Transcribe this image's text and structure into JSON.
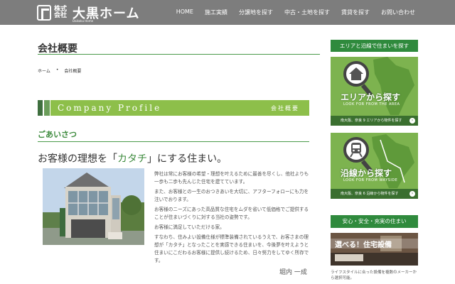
{
  "header": {
    "logo_small": "株式会社",
    "logo_big": "大黒ホーム",
    "logo_sub": "Daikoku Home",
    "nav": [
      "HOME",
      "施工実績",
      "分譲地を探す",
      "中古・土地を探す",
      "賃貸を探す",
      "お問い合わせ"
    ]
  },
  "main": {
    "page_title": "会社概要",
    "breadcrumb": [
      "ホーム",
      "会社概要"
    ],
    "profile_en": "Company Profile",
    "profile_ja": "会社概要",
    "greeting_title": "ごあいさつ",
    "headline_pre": "お客様の理想を「",
    "headline_hl": "カタチ",
    "headline_post": "」にする住まい。",
    "paragraphs": [
      "弊社は常にお客様の希望・理想を叶えるために最善を尽くし、他社よりも一歩も二歩も先んじた住宅を建てています。",
      "また、お客様との一生のおつきあいを大切に、アフターフォローにも力を注いでおります。",
      "お客様のニーズにあった高品質な住宅をムダを省いて低価格でご提供することが住まいづくりに対する当社の姿勢です。",
      "お客様に満足していただける家。",
      "すなわち、住みよい設備仕様が標準装備されているうえで、お客さまの理想が「カタチ」となったことを実感できる住まいを、今後夢を叶えようと住まいにこだわるお客様に提供し続けるため、日々努力をしてゆく所存です。"
    ],
    "signature": "堀内 一成"
  },
  "sidebar": {
    "head1": "エリアと沿線で住まいを探す",
    "banner1": {
      "main": "エリアから探す",
      "en": "LOOK FOR FROM THE AREA",
      "foot": "南大阪、奈良 9 エリアから物件を探す"
    },
    "banner2": {
      "main": "沿線から探す",
      "en": "LOOK FOR FROM WAYSIDE",
      "foot": "南大阪、奈良 6 沿線から物件を探す"
    },
    "head2": "安心・安全・充実の住まい",
    "equip_label": "選べる！住宅設備",
    "equip_caption": "ライフスタイルに合った設備を複数のメーカーから選択可能。"
  }
}
